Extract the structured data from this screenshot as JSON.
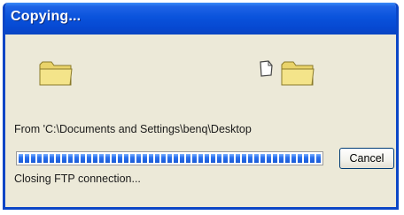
{
  "window": {
    "title": "Copying..."
  },
  "icons": {
    "source": "folder-icon",
    "moving_file": "document-icon",
    "destination": "folder-icon"
  },
  "copy": {
    "from_text": "From 'C:\\Documents and Settings\\benq\\Desktop",
    "status_text": "Closing FTP connection..."
  },
  "progress": {
    "fraction": 1.0
  },
  "buttons": {
    "cancel_label": "Cancel"
  },
  "colors": {
    "titlebar": "#0a53dc",
    "dialog_bg": "#ece9d8",
    "folder": "#f4e48a",
    "progress_fill": "#2a72ef"
  }
}
